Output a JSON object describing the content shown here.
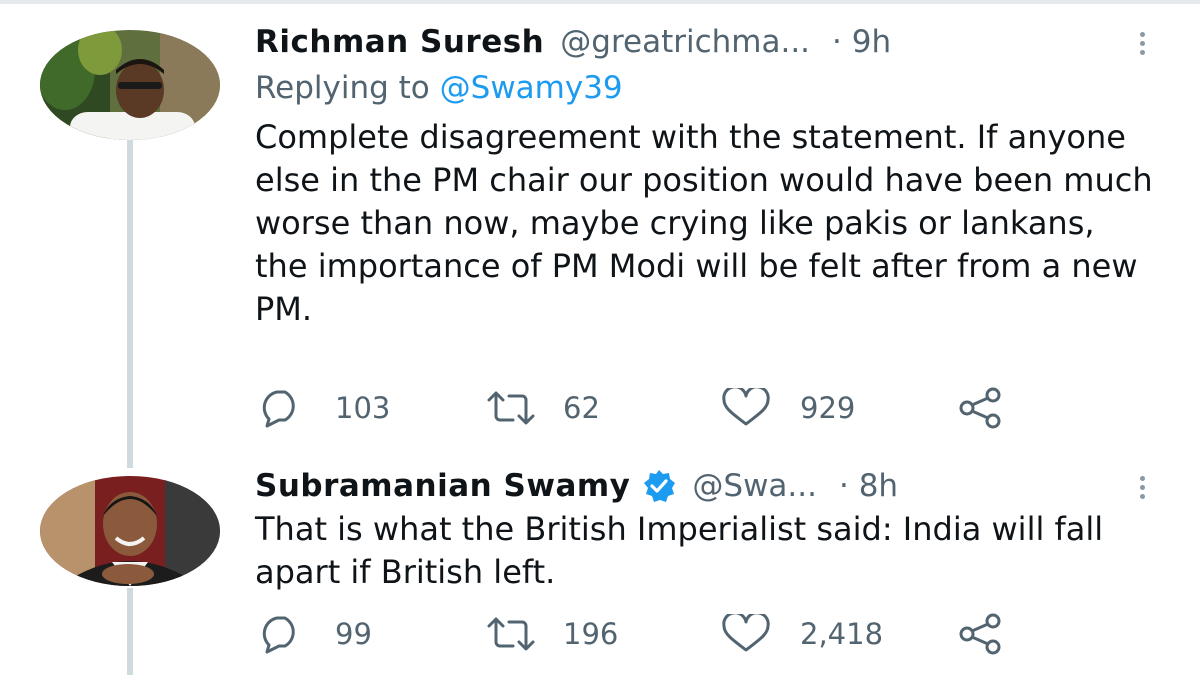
{
  "tweets": [
    {
      "name": "Richman Suresh",
      "handle": "@greatrichma...",
      "time": "· 9h",
      "replying_label": "Replying to",
      "replying_to": "@Swamy39",
      "verified": false,
      "text": "Complete disagreement with the statement. If anyone else in the PM chair our position would have been much worse than now, maybe crying like pakis or lankans, the importance of PM Modi will be felt after from a new PM.",
      "replies": "103",
      "retweets": "62",
      "likes": "929"
    },
    {
      "name": "Subramanian Swamy",
      "handle": "@Swa...",
      "time": "· 8h",
      "verified": true,
      "text": "That is what the British Imperialist said: India will fall apart if British left.",
      "replies": "99",
      "retweets": "196",
      "likes": "2,418"
    }
  ],
  "icons": {
    "reply": "reply-icon",
    "retweet": "retweet-icon",
    "like": "heart-icon",
    "share": "share-icon",
    "more": "more-icon",
    "verified": "verified-badge-icon"
  },
  "colors": {
    "text": "#0f1419",
    "secondary": "#536471",
    "link": "#1d9bf0",
    "thread_line": "#cfd9de"
  }
}
